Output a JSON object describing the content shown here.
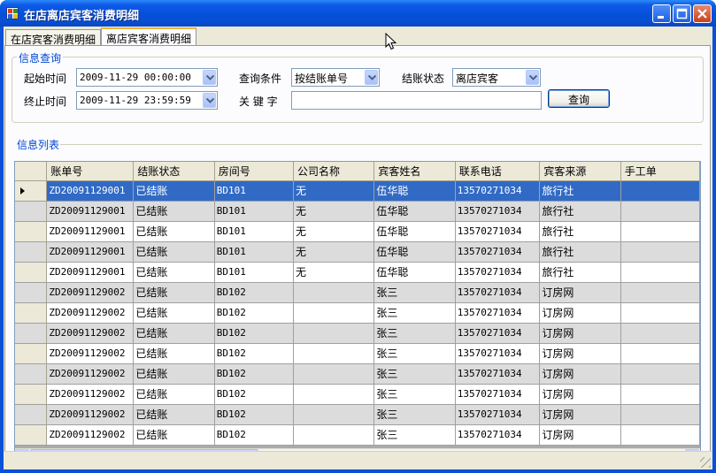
{
  "window": {
    "title": "在店离店宾客消费明细"
  },
  "tabs": [
    {
      "label": "在店宾客消费明细",
      "active": false
    },
    {
      "label": "离店宾客消费明细",
      "active": true
    }
  ],
  "query": {
    "legend": "信息查询",
    "start_label": "起始时间",
    "start_value": "2009-11-29 00:00:00",
    "end_label": "终止时间",
    "end_value": "2009-11-29 23:59:59",
    "condition_label": "查询条件",
    "condition_value": "按结账单号",
    "status_label": "结账状态",
    "status_value": "离店宾客",
    "keyword_label": "关 键 字",
    "keyword_value": "",
    "search_button": "查询"
  },
  "list": {
    "legend": "信息列表",
    "columns": [
      "账单号",
      "结账状态",
      "房间号",
      "公司名称",
      "宾客姓名",
      "联系电话",
      "宾客来源",
      "手工单"
    ],
    "rows": [
      [
        "ZD20091129001",
        "已结账",
        "BD101",
        "无",
        "伍华聪",
        "13570271034",
        "旅行社",
        ""
      ],
      [
        "ZD20091129001",
        "已结账",
        "BD101",
        "无",
        "伍华聪",
        "13570271034",
        "旅行社",
        ""
      ],
      [
        "ZD20091129001",
        "已结账",
        "BD101",
        "无",
        "伍华聪",
        "13570271034",
        "旅行社",
        ""
      ],
      [
        "ZD20091129001",
        "已结账",
        "BD101",
        "无",
        "伍华聪",
        "13570271034",
        "旅行社",
        ""
      ],
      [
        "ZD20091129001",
        "已结账",
        "BD101",
        "无",
        "伍华聪",
        "13570271034",
        "旅行社",
        ""
      ],
      [
        "ZD20091129002",
        "已结账",
        "BD102",
        "",
        "张三",
        "13570271034",
        "订房网",
        ""
      ],
      [
        "ZD20091129002",
        "已结账",
        "BD102",
        "",
        "张三",
        "13570271034",
        "订房网",
        ""
      ],
      [
        "ZD20091129002",
        "已结账",
        "BD102",
        "",
        "张三",
        "13570271034",
        "订房网",
        ""
      ],
      [
        "ZD20091129002",
        "已结账",
        "BD102",
        "",
        "张三",
        "13570271034",
        "订房网",
        ""
      ],
      [
        "ZD20091129002",
        "已结账",
        "BD102",
        "",
        "张三",
        "13570271034",
        "订房网",
        ""
      ],
      [
        "ZD20091129002",
        "已结账",
        "BD102",
        "",
        "张三",
        "13570271034",
        "订房网",
        ""
      ],
      [
        "ZD20091129002",
        "已结账",
        "BD102",
        "",
        "张三",
        "13570271034",
        "订房网",
        ""
      ],
      [
        "ZD20091129002",
        "已结账",
        "BD102",
        "",
        "张三",
        "13570271034",
        "订房网",
        ""
      ]
    ],
    "selected_row": 0
  },
  "colors": {
    "selection": "#316ac5",
    "alt_row": "#dcdcdc",
    "legend_text": "#0046d5"
  }
}
